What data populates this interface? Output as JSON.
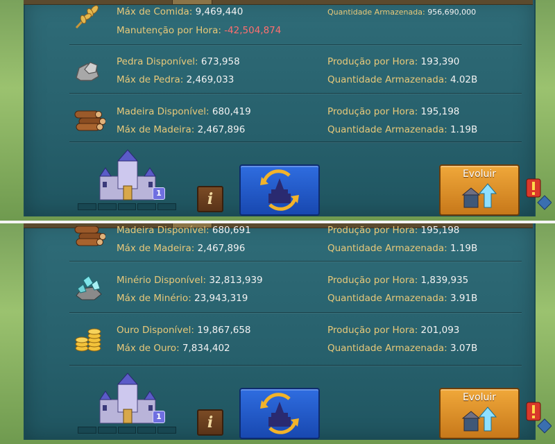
{
  "top": {
    "rows": [
      {
        "left_label": "Máx de Comida:",
        "left_value": "9,469,440",
        "right_label": "Quantidade Armazenada:",
        "right_value": "956,690,000"
      },
      {
        "left_label": "Manutenção por Hora:",
        "left_value": "-42,504,874"
      },
      {
        "left_label": "Pedra Disponível:",
        "left_value": "673,958",
        "right_label": "Produção por Hora:",
        "right_value": "193,390"
      },
      {
        "left_label": "Máx de Pedra:",
        "left_value": "2,469,033",
        "right_label": "Quantidade Armazenada:",
        "right_value": "4.02B"
      },
      {
        "left_label": "Madeira Disponível:",
        "left_value": "680,419",
        "right_label": "Produção por Hora:",
        "right_value": "195,198"
      },
      {
        "left_label": "Máx de Madeira:",
        "left_value": "2,467,896",
        "right_label": "Quantidade Armazenada:",
        "right_value": "1.19B"
      }
    ],
    "castle_level": "1",
    "info_label": "i",
    "evolve_label": "Evoluir"
  },
  "bottom": {
    "rows": [
      {
        "left_label": "Madeira Disponível:",
        "left_value": "680,691",
        "right_label": "Produção por Hora:",
        "right_value": "195,198"
      },
      {
        "left_label": "Máx de Madeira:",
        "left_value": "2,467,896",
        "right_label": "Quantidade Armazenada:",
        "right_value": "1.19B"
      },
      {
        "left_label": "Minério Disponível:",
        "left_value": "32,813,939",
        "right_label": "Produção por Hora:",
        "right_value": "1,839,935"
      },
      {
        "left_label": "Máx de Minério:",
        "left_value": "23,943,319",
        "right_label": "Quantidade Armazenada:",
        "right_value": "3.91B"
      },
      {
        "left_label": "Ouro Disponível:",
        "left_value": "19,867,658",
        "right_label": "Produção por Hora:",
        "right_value": "201,093"
      },
      {
        "left_label": "Máx de Ouro:",
        "left_value": "7,834,402",
        "right_label": "Quantidade Armazenada:",
        "right_value": "3.07B"
      }
    ],
    "castle_level": "1",
    "info_label": "i",
    "evolve_label": "Evoluir"
  },
  "icons": {
    "food": "wheat-icon",
    "stone": "stone-icon",
    "wood": "wood-icon",
    "ore": "ore-icon",
    "gold": "gold-icon",
    "castle": "castle-icon",
    "switch": "castle-switch-icon",
    "evolve": "upgrade-arrow-icon"
  },
  "colors": {
    "panel": "#2a6470",
    "label": "#e9c979",
    "value": "#f3f3f3",
    "negative": "#ff6f6f"
  }
}
